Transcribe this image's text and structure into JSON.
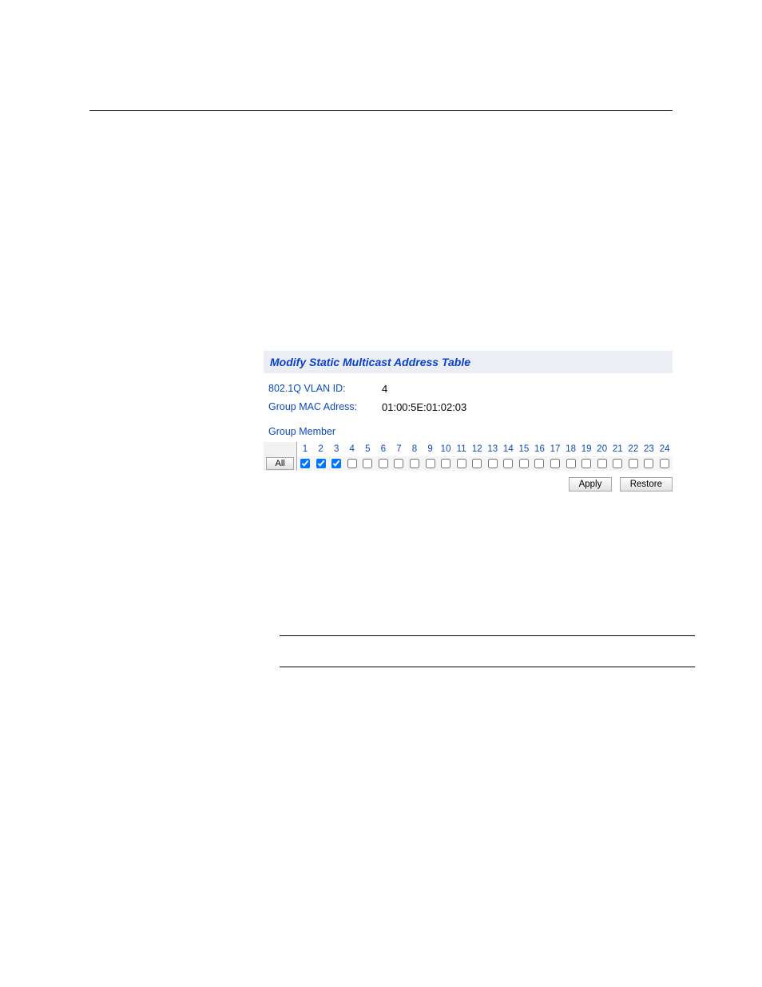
{
  "panel": {
    "title": "Modify Static Multicast Address Table",
    "fields": {
      "vlan_label": "802.1Q VLAN ID:",
      "vlan_value": "4",
      "mac_label": "Group MAC Adress:",
      "mac_value": "01:00:5E:01:02:03"
    },
    "group_member_label": "Group Member",
    "all_button": "All",
    "ports": [
      {
        "num": "1",
        "checked": true
      },
      {
        "num": "2",
        "checked": true
      },
      {
        "num": "3",
        "checked": true
      },
      {
        "num": "4",
        "checked": false
      },
      {
        "num": "5",
        "checked": false
      },
      {
        "num": "6",
        "checked": false
      },
      {
        "num": "7",
        "checked": false
      },
      {
        "num": "8",
        "checked": false
      },
      {
        "num": "9",
        "checked": false
      },
      {
        "num": "10",
        "checked": false
      },
      {
        "num": "11",
        "checked": false
      },
      {
        "num": "12",
        "checked": false
      },
      {
        "num": "13",
        "checked": false
      },
      {
        "num": "14",
        "checked": false
      },
      {
        "num": "15",
        "checked": false
      },
      {
        "num": "16",
        "checked": false
      },
      {
        "num": "17",
        "checked": false
      },
      {
        "num": "18",
        "checked": false
      },
      {
        "num": "19",
        "checked": false
      },
      {
        "num": "20",
        "checked": false
      },
      {
        "num": "21",
        "checked": false
      },
      {
        "num": "22",
        "checked": false
      },
      {
        "num": "23",
        "checked": false
      },
      {
        "num": "24",
        "checked": false
      }
    ],
    "apply_label": "Apply",
    "restore_label": "Restore"
  }
}
